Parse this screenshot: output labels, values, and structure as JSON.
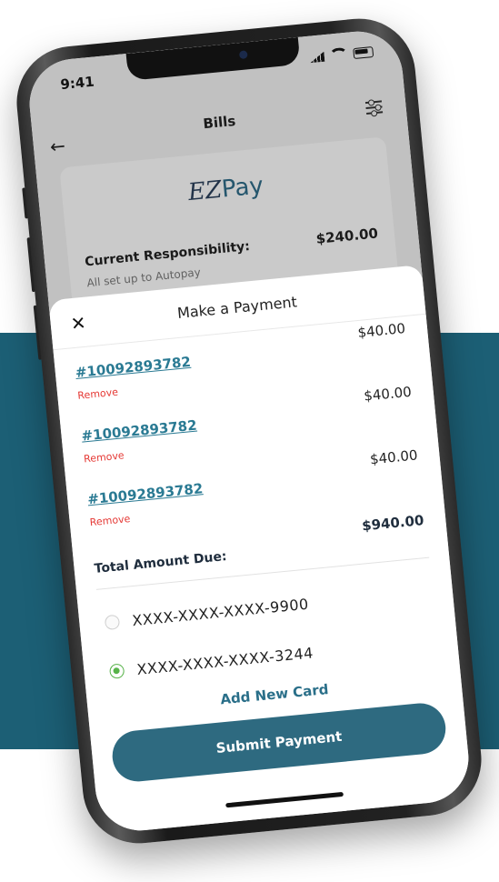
{
  "status_bar": {
    "time": "9:41"
  },
  "header": {
    "title": "Bills"
  },
  "ezpay_card": {
    "logo_ez": "EZ",
    "logo_pay": "Pay",
    "responsibility_label": "Current Responsibility:",
    "responsibility_amount": "$240.00",
    "autopay_text": "All set up to Autopay"
  },
  "sheet": {
    "title": "Make a Payment",
    "bills": [
      {
        "number": "#10092893782",
        "amount": "$40.00",
        "remove": "Remove"
      },
      {
        "number": "#10092893782",
        "amount": "$40.00",
        "remove": "Remove"
      },
      {
        "number": "#10092893782",
        "amount": "$40.00",
        "remove": "Remove"
      }
    ],
    "total_label": "Total Amount Due:",
    "total_amount": "$940.00",
    "cards": [
      {
        "number": "XXXX-XXXX-XXXX-9900",
        "selected": false
      },
      {
        "number": "XXXX-XXXX-XXXX-3244",
        "selected": true
      }
    ],
    "add_card": "Add New Card",
    "submit": "Submit Payment"
  },
  "colors": {
    "band": "#1c5f75",
    "accent": "#2e6a80",
    "remove": "#e53935",
    "selected_radio": "#58b34a"
  }
}
